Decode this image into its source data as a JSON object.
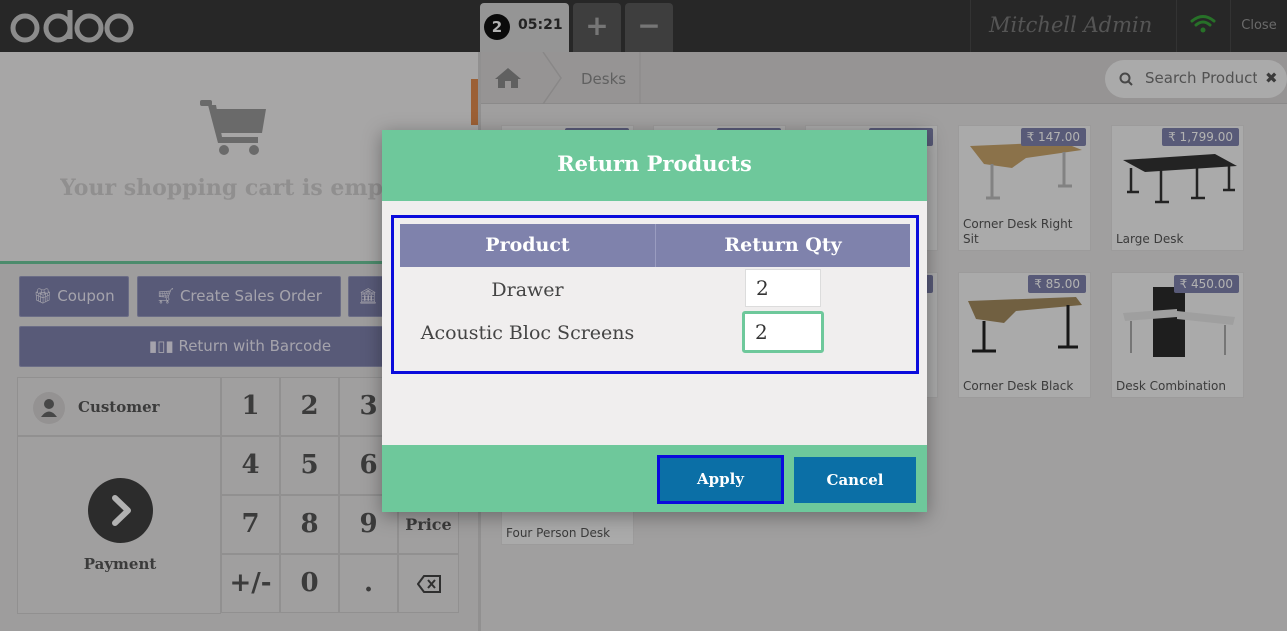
{
  "topbar": {
    "logo_text": "odoo",
    "order_number": "2",
    "order_time": "05:21",
    "add_order_label": "+",
    "remove_order_label": "−",
    "user_name": "Mitchell Admin",
    "close_label": "Close",
    "wifi_icon": "wifi-icon",
    "wifi_color": "#38a33a"
  },
  "cart": {
    "empty_text": "Your shopping cart is empty",
    "icon": "shopping-cart-icon"
  },
  "controls": {
    "coupon_label": "Coupon",
    "create_sales_order_label": "Create Sales Order",
    "return_barcode_label": "Return with Barcode"
  },
  "numpad": {
    "customer_label": "Customer",
    "payment_label": "Payment",
    "keys": [
      "1",
      "2",
      "3",
      "4",
      "5",
      "6",
      "7",
      "8",
      "9",
      "+/-",
      "0",
      "."
    ],
    "price_label": "Price"
  },
  "products_panel": {
    "breadcrumb_category": "Desks",
    "search_placeholder": "Search Products",
    "items": [
      {
        "name": "Corner Desk Right Sit",
        "price": "₹ 147.00"
      },
      {
        "name": "Large Desk",
        "price": "₹ 1,799.00"
      },
      {
        "name": "Corner Desk Black",
        "price": "₹ 85.00"
      },
      {
        "name": "Desk Combination",
        "price": "₹ 450.00"
      },
      {
        "name": "Four Person Desk",
        "price": ""
      }
    ]
  },
  "modal": {
    "title": "Return Products",
    "columns": [
      "Product",
      "Return Qty"
    ],
    "rows": [
      {
        "product": "Drawer",
        "qty": "2"
      },
      {
        "product": "Acoustic Bloc Screens",
        "qty": "2"
      }
    ],
    "apply_label": "Apply",
    "cancel_label": "Cancel"
  },
  "colors": {
    "accent_green": "#6ec89b",
    "primary_blue": "#0b6fa6",
    "header_purple": "#7f82ac",
    "highlight_border": "#0b0bdc"
  }
}
